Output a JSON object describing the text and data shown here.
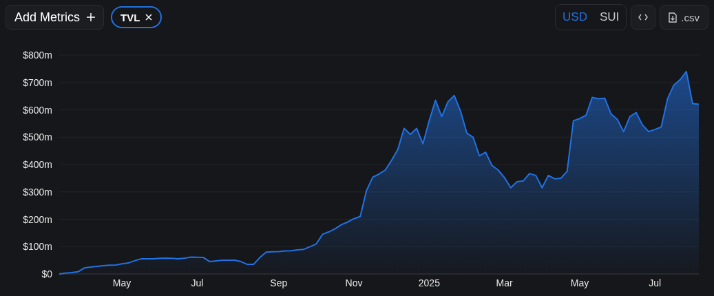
{
  "toolbar": {
    "add_metrics": {
      "label": "Add Metrics"
    },
    "metrics": [
      {
        "label": "TVL"
      }
    ],
    "currencies": [
      {
        "label": "USD",
        "selected": true
      },
      {
        "label": "SUI",
        "selected": false
      }
    ],
    "csv_button": {
      "label": ".csv"
    }
  },
  "chart": {
    "chart_data": {
      "type": "area",
      "grid": true,
      "ylim": [
        0,
        800
      ],
      "yticks": [
        {
          "value": 0,
          "label": "$0"
        },
        {
          "value": 100,
          "label": "$100m"
        },
        {
          "value": 200,
          "label": "$200m"
        },
        {
          "value": 300,
          "label": "$300m"
        },
        {
          "value": 400,
          "label": "$400m"
        },
        {
          "value": 500,
          "label": "$500m"
        },
        {
          "value": 600,
          "label": "$600m"
        },
        {
          "value": 700,
          "label": "$700m"
        },
        {
          "value": 800,
          "label": "$800m"
        }
      ],
      "categories": [
        null,
        null,
        null,
        null,
        null,
        null,
        null,
        null,
        null,
        null,
        "May",
        null,
        null,
        null,
        null,
        null,
        null,
        null,
        null,
        null,
        null,
        null,
        "Jul",
        null,
        null,
        null,
        null,
        null,
        null,
        null,
        null,
        null,
        null,
        null,
        null,
        "Sep",
        null,
        null,
        null,
        null,
        null,
        null,
        null,
        null,
        null,
        null,
        null,
        "Nov",
        null,
        null,
        null,
        null,
        null,
        null,
        null,
        null,
        null,
        null,
        null,
        "2025",
        null,
        null,
        null,
        null,
        null,
        null,
        null,
        null,
        null,
        null,
        null,
        "Mar",
        null,
        null,
        null,
        null,
        null,
        null,
        null,
        null,
        null,
        null,
        null,
        "May",
        null,
        null,
        null,
        null,
        null,
        null,
        null,
        null,
        null,
        null,
        null,
        "Jul",
        null,
        null,
        null,
        null,
        null,
        null,
        null
      ],
      "series": [
        {
          "color": "#2172e5",
          "values": [
            0,
            3,
            5,
            8,
            22,
            25,
            28,
            30,
            32,
            33,
            37,
            40,
            48,
            55,
            55,
            55,
            57,
            58,
            57,
            55,
            58,
            62,
            61,
            60,
            45,
            48,
            50,
            50,
            50,
            45,
            35,
            35,
            60,
            80,
            81,
            82,
            84,
            85,
            88,
            90,
            100,
            110,
            145,
            154,
            165,
            180,
            190,
            202,
            210,
            305,
            354,
            365,
            380,
            415,
            455,
            532,
            510,
            532,
            476,
            560,
            635,
            575,
            630,
            652,
            595,
            515,
            500,
            432,
            445,
            397,
            380,
            352,
            315,
            337,
            340,
            367,
            360,
            315,
            360,
            348,
            350,
            375,
            560,
            568,
            580,
            645,
            640,
            642,
            585,
            565,
            520,
            575,
            590,
            545,
            520,
            528,
            537,
            640,
            690,
            710,
            740,
            623,
            620
          ]
        }
      ]
    }
  }
}
